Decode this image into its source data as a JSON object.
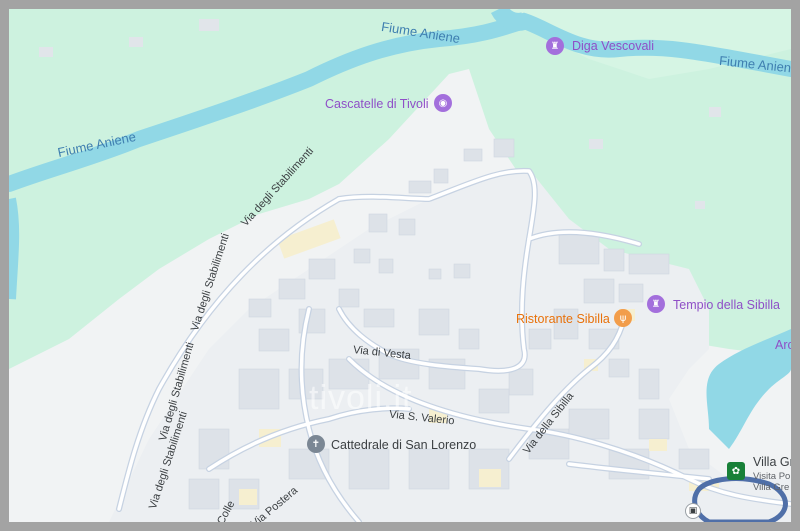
{
  "map": {
    "colors": {
      "land": "#f1f3f4",
      "park": "#cdf2df",
      "water": "#91d8e6",
      "road": "#ffffff",
      "road_outline": "#c6d2e2",
      "building": "#e1e5ea",
      "poi_purple": "#8f4fc7",
      "poi_orange": "#e8710a"
    },
    "rivers": [
      {
        "label": "Fiume Aniene"
      },
      {
        "label": "Fiume Aniene"
      },
      {
        "label": "Fiume Aniene"
      }
    ],
    "pois": {
      "diga": {
        "label": "Diga Vescovali",
        "icon": "monument-icon"
      },
      "cascatelle": {
        "label": "Cascatelle di Tivoli",
        "icon": "camera-icon"
      },
      "ristorante": {
        "label": "Ristorante Sibilla",
        "icon": "restaurant-icon"
      },
      "tempio": {
        "label": "Tempio della Sibilla",
        "icon": "monument-icon"
      },
      "cattedrale": {
        "label": "Cattedrale di San Lorenzo",
        "icon": "church-icon"
      },
      "villa": {
        "label": "Villa Gr",
        "sub1": "Visita Po",
        "sub2": "Villa Gre",
        "icon": "park-icon"
      },
      "arco": {
        "label": "Arc"
      }
    },
    "streets": {
      "stabilimenti_1": "Via degli Stabilimenti",
      "stabilimenti_2": "Via degli Stabilimenti",
      "stabilimenti_3": "Via degli Stabilimenti",
      "stabilimenti_4": "Via degli Stabilimenti",
      "vesta": "Via di Vesta",
      "valerio": "Via S. Valerio",
      "sibilla": "Via della Sibilla",
      "postera": "Via Postera",
      "colle": "Colle"
    },
    "watermark": "tivoli.it"
  }
}
